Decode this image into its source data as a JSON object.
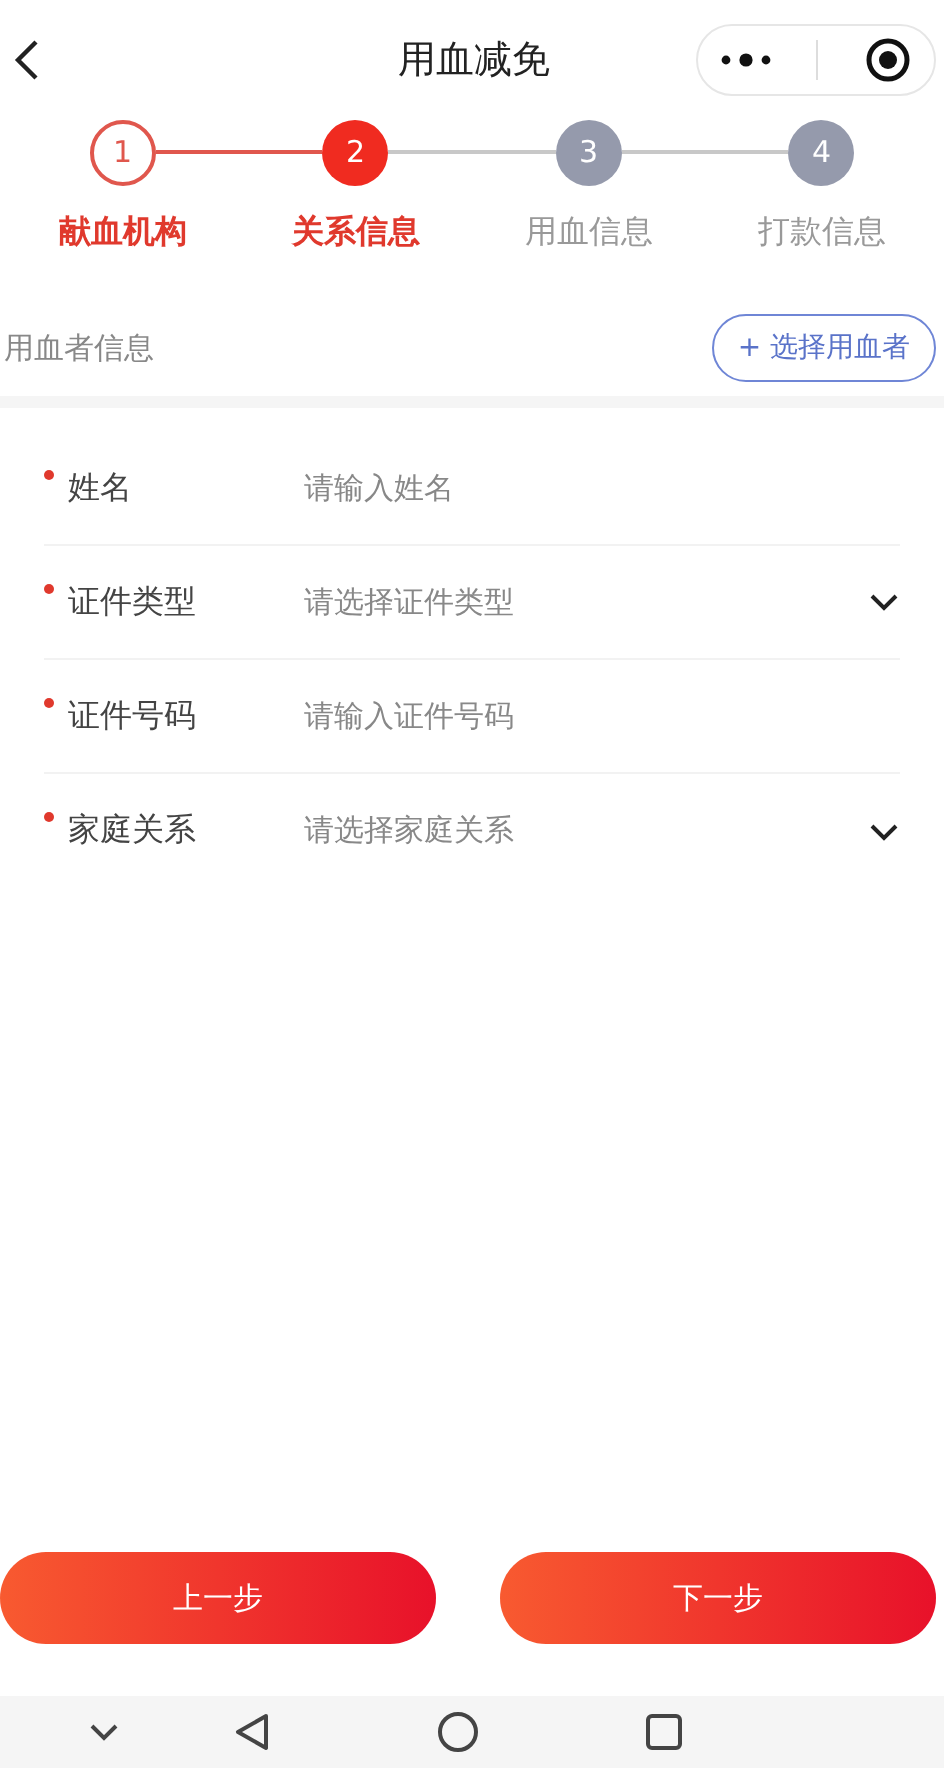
{
  "header": {
    "title": "用血减免"
  },
  "steps": [
    {
      "number": "1",
      "label": "献血机构",
      "kind": "done"
    },
    {
      "number": "2",
      "label": "关系信息",
      "kind": "current"
    },
    {
      "number": "3",
      "label": "用血信息",
      "kind": "todo"
    },
    {
      "number": "4",
      "label": "打款信息",
      "kind": "todo"
    }
  ],
  "section": {
    "title": "用血者信息",
    "action": "+ 选择用血者"
  },
  "fields": [
    {
      "kind": "input",
      "label": "姓名",
      "placeholder": "请输入姓名",
      "required": true
    },
    {
      "kind": "select",
      "label": "证件类型",
      "placeholder": "请选择证件类型",
      "required": true
    },
    {
      "kind": "input",
      "label": "证件号码",
      "placeholder": "请输入证件号码",
      "required": true
    },
    {
      "kind": "select",
      "label": "家庭关系",
      "placeholder": "请选择家庭关系",
      "required": true
    }
  ],
  "buttons": [
    "上一步",
    "下一步"
  ]
}
